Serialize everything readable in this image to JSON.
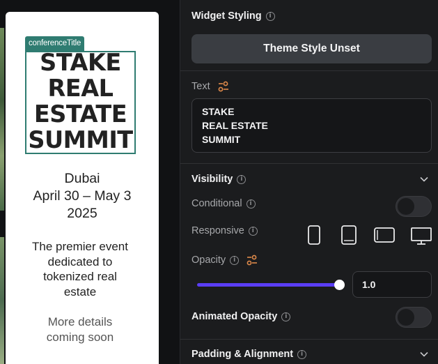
{
  "preview": {
    "tag": "conferenceTitle",
    "title": "STAKE\nREAL\nESTATE\nSUMMIT",
    "city": "Dubai",
    "dates": "April 30 – May 3\n2025",
    "description": "The premier event\ndedicated to\ntokenized real\nestate",
    "more": "More details\ncoming soon"
  },
  "panel": {
    "widget_styling": {
      "title": "Widget Styling",
      "button": "Theme Style Unset"
    },
    "text": {
      "label": "Text",
      "value": "STAKE\nREAL ESTATE\nSUMMIT"
    },
    "visibility": {
      "title": "Visibility",
      "conditional_label": "Conditional",
      "responsive_label": "Responsive",
      "devices": [
        "mobile-icon",
        "tablet-portrait-icon",
        "tablet-landscape-icon",
        "desktop-icon"
      ],
      "opacity_label": "Opacity",
      "opacity_value": "1.0",
      "opacity_fraction": 1.0,
      "animated_opacity_label": "Animated Opacity"
    },
    "padding": {
      "title": "Padding & Alignment"
    }
  },
  "colors": {
    "accent": "#5a3df5",
    "tag": "#2f7c71",
    "tune_icon": "#e08a4a"
  }
}
